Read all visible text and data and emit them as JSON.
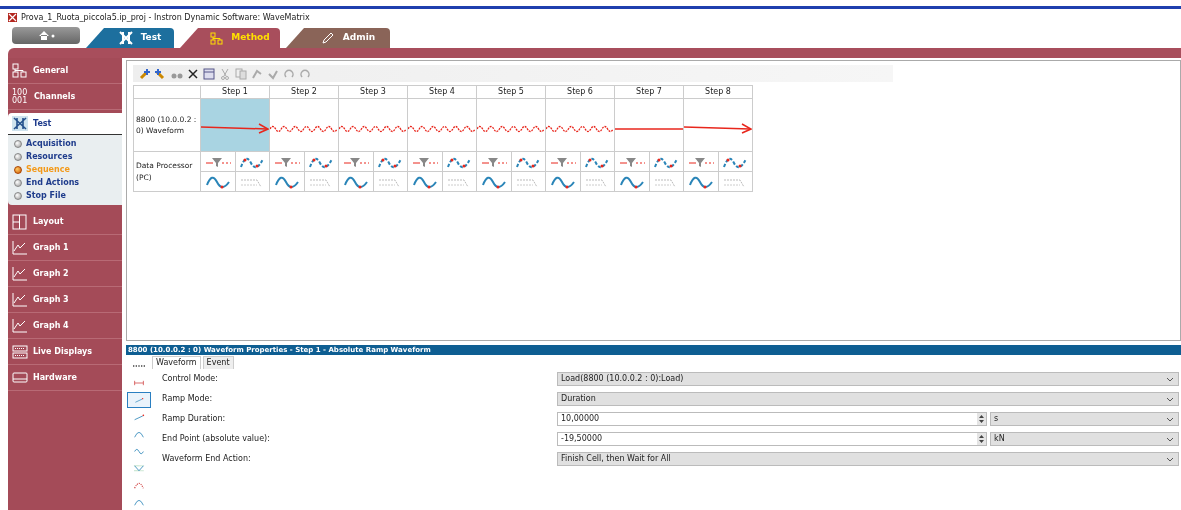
{
  "window": {
    "title": "Prova_1_Ruota_piccola5.ip_proj - Instron Dynamic Software: WaveMatrix"
  },
  "top_tabs": [
    {
      "kind": "test",
      "label": "Test",
      "selected": false,
      "color": "#1d6f9e"
    },
    {
      "kind": "method",
      "label": "Method",
      "selected": true,
      "color": "#a84e5c"
    },
    {
      "kind": "admin",
      "label": "Admin",
      "selected": false,
      "color": "#8a6458"
    }
  ],
  "sidebar": {
    "items": [
      {
        "kind": "general",
        "label": "General",
        "expanded": false
      },
      {
        "kind": "channels",
        "label": "Channels",
        "expanded": false,
        "icon_text": [
          "100",
          "001"
        ]
      },
      {
        "kind": "test",
        "label": "Test",
        "expanded": true,
        "children": [
          {
            "label": "Acquisition",
            "selected": false
          },
          {
            "label": "Resources",
            "selected": false
          },
          {
            "label": "Sequence",
            "selected": true
          },
          {
            "label": "End Actions",
            "selected": false
          },
          {
            "label": "Stop File",
            "selected": false
          }
        ]
      },
      {
        "kind": "layout",
        "label": "Layout",
        "expanded": false
      },
      {
        "kind": "graph",
        "label": "Graph 1",
        "expanded": false
      },
      {
        "kind": "graph",
        "label": "Graph 2",
        "expanded": false
      },
      {
        "kind": "graph",
        "label": "Graph 3",
        "expanded": false
      },
      {
        "kind": "graph",
        "label": "Graph 4",
        "expanded": false
      },
      {
        "kind": "displays",
        "label": "Live Displays",
        "expanded": false
      },
      {
        "kind": "hardware",
        "label": "Hardware",
        "expanded": false
      }
    ]
  },
  "sequence": {
    "steps": [
      "Step 1",
      "Step 2",
      "Step 3",
      "Step 4",
      "Step 5",
      "Step 6",
      "Step 7",
      "Step 8"
    ],
    "waveform_row": {
      "label": "8800 (10.0.0.2 : 0) Waveform",
      "cells": [
        {
          "kind": "ramp",
          "selected": true
        },
        {
          "kind": "sine",
          "selected": false
        },
        {
          "kind": "sine",
          "selected": false
        },
        {
          "kind": "sine",
          "selected": false
        },
        {
          "kind": "sine",
          "selected": false
        },
        {
          "kind": "sine",
          "selected": false
        },
        {
          "kind": "hold",
          "selected": false
        },
        {
          "kind": "ramp",
          "selected": false
        }
      ]
    },
    "processor_row": {
      "label": "Data Processor (PC)"
    }
  },
  "properties": {
    "title": "8800 (10.0.0.2 : 0) Waveform Properties - Step 1 - Absolute Ramp Waveform",
    "palette": [
      {
        "kind": "dots",
        "selected": false
      },
      {
        "kind": "span",
        "selected": false
      },
      {
        "kind": "ramp",
        "selected": true
      },
      {
        "kind": "ramp",
        "selected": false
      },
      {
        "kind": "haversine",
        "selected": false
      },
      {
        "kind": "sine",
        "selected": false
      },
      {
        "kind": "block",
        "selected": false
      },
      {
        "kind": "dotted",
        "selected": false
      },
      {
        "kind": "haversine",
        "selected": false
      }
    ],
    "tabs": [
      {
        "label": "Waveform",
        "selected": true
      },
      {
        "label": "Event",
        "selected": false
      }
    ],
    "fields": [
      {
        "kind": "select",
        "label": "Control Mode:",
        "value": "Load(8800 (10.0.0.2 : 0):Load)"
      },
      {
        "kind": "select",
        "label": "Ramp Mode:",
        "value": "Duration"
      },
      {
        "kind": "spin",
        "label": "Ramp Duration:",
        "value": "10,00000",
        "unit": "s"
      },
      {
        "kind": "spin",
        "label": "End Point (absolute value):",
        "value": "-19,50000",
        "unit": "kN"
      },
      {
        "kind": "select",
        "label": "Waveform End Action:",
        "value": "Finish Cell, then Wait for All"
      }
    ]
  }
}
